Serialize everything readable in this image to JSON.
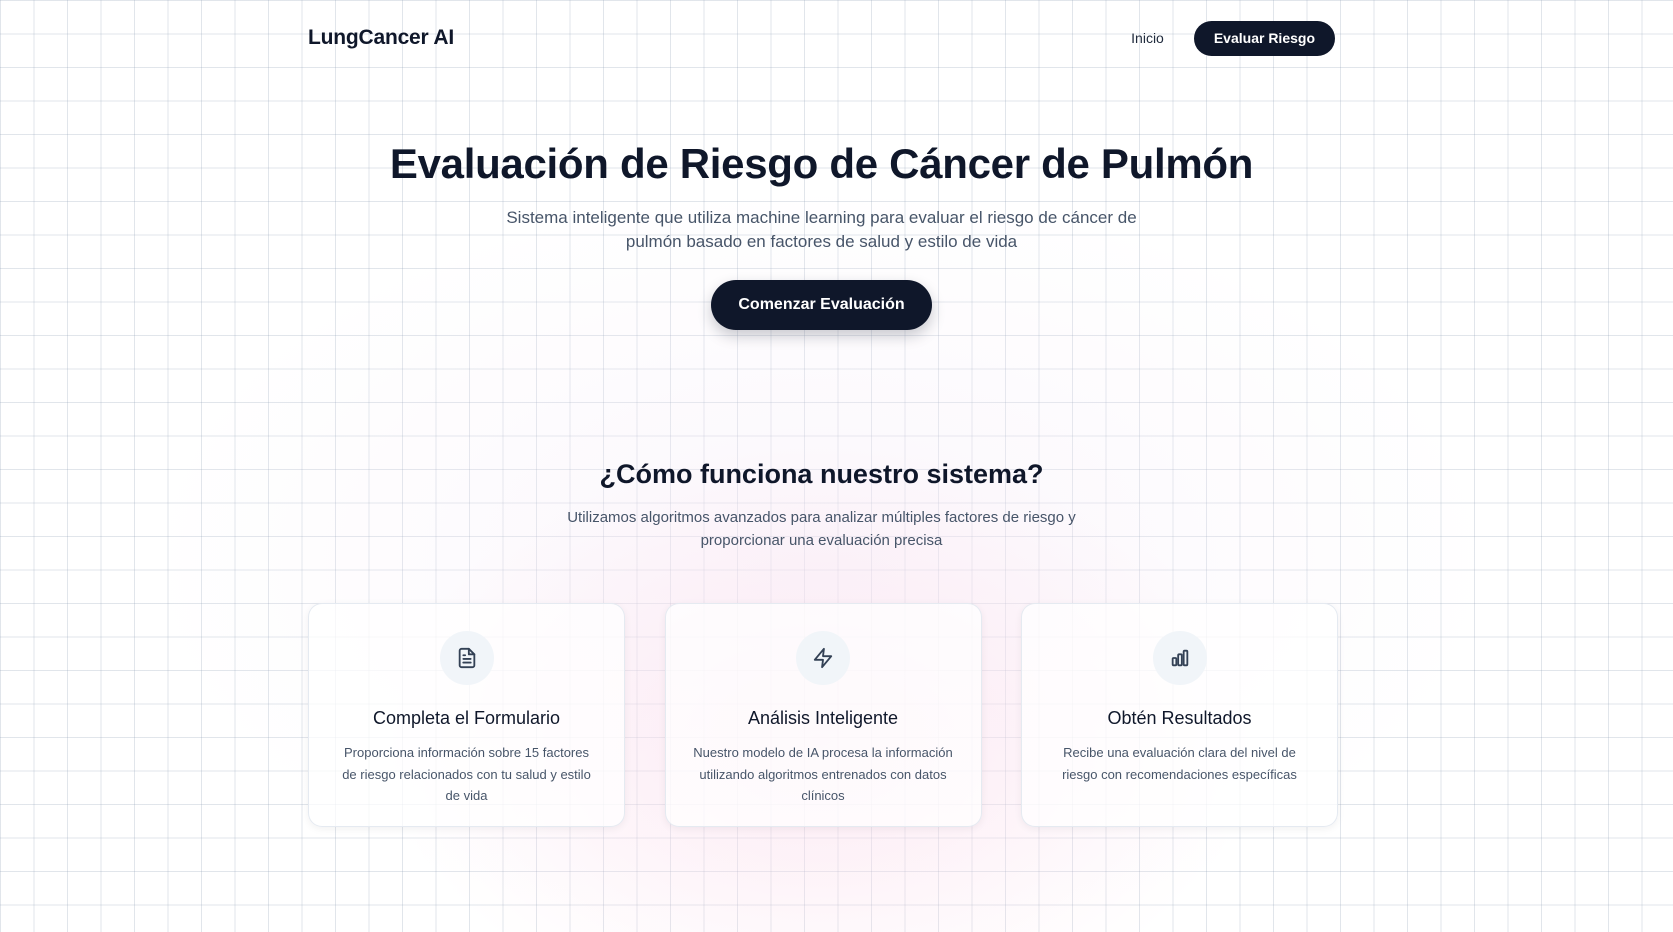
{
  "header": {
    "brand": "LungCancer AI",
    "nav": {
      "home_label": "Inicio",
      "cta_label": "Evaluar Riesgo"
    }
  },
  "hero": {
    "title": "Evaluación de Riesgo de Cáncer de Pulmón",
    "subtitle": "Sistema inteligente que utiliza machine learning para evaluar el riesgo de cáncer de pulmón basado en factores de salud y estilo de vida",
    "cta_label": "Comenzar Evaluación"
  },
  "how": {
    "title": "¿Cómo funciona nuestro sistema?",
    "subtitle": "Utilizamos algoritmos avanzados para analizar múltiples factores de riesgo y proporcionar una evaluación precisa",
    "cards": [
      {
        "icon": "file-text-icon",
        "title": "Completa el Formulario",
        "description": "Proporciona información sobre 15 factores de riesgo relacionados con tu salud y estilo de vida"
      },
      {
        "icon": "lightning-icon",
        "title": "Análisis Inteligente",
        "description": "Nuestro modelo de IA procesa la información utilizando algoritmos entrenados con datos clínicos"
      },
      {
        "icon": "bar-chart-icon",
        "title": "Obtén Resultados",
        "description": "Recibe una evaluación clara del nivel de riesgo con recomendaciones específicas"
      }
    ]
  },
  "colors": {
    "primary": "#0f172a",
    "muted_text": "#475569",
    "icon_bg": "#f1f5f9"
  }
}
